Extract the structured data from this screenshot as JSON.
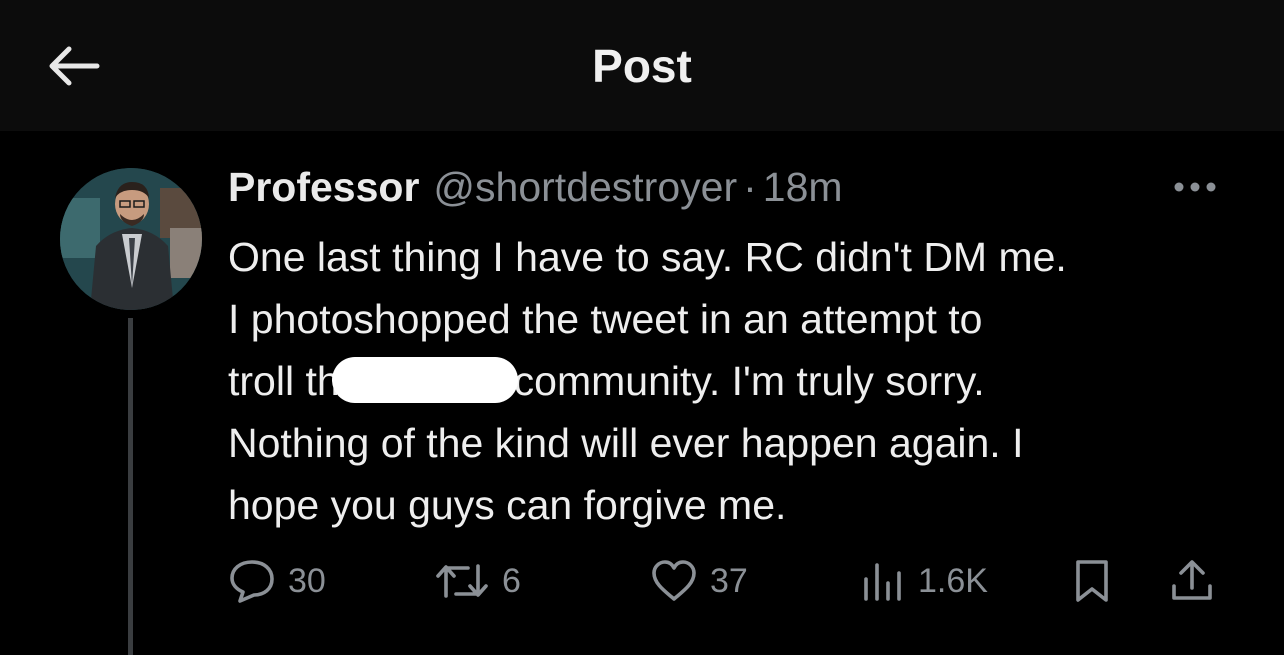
{
  "header": {
    "title": "Post",
    "back_icon": "arrow-left-icon"
  },
  "post": {
    "display_name": "Professor",
    "handle": "@shortdestroyer",
    "separator": "·",
    "time": "18m",
    "more_icon": "more-horizontal-icon",
    "lines": [
      "One last thing I have to say.  RC didn't DM me.",
      "I photoshopped the tweet in an attempt to",
      "Nothing of the kind will ever happen again.  I",
      "hope you guys can forgive me."
    ],
    "line3_before": "troll th",
    "line3_after": "community.  I'm truly sorry."
  },
  "actions": {
    "reply_count": "30",
    "repost_count": "6",
    "like_count": "37",
    "views_count": "1.6K"
  },
  "colors": {
    "background": "#000000",
    "header_bg": "#0c0c0c",
    "text": "#e7e9ea",
    "muted": "#8b9096",
    "thread_line": "#3a3d40"
  }
}
